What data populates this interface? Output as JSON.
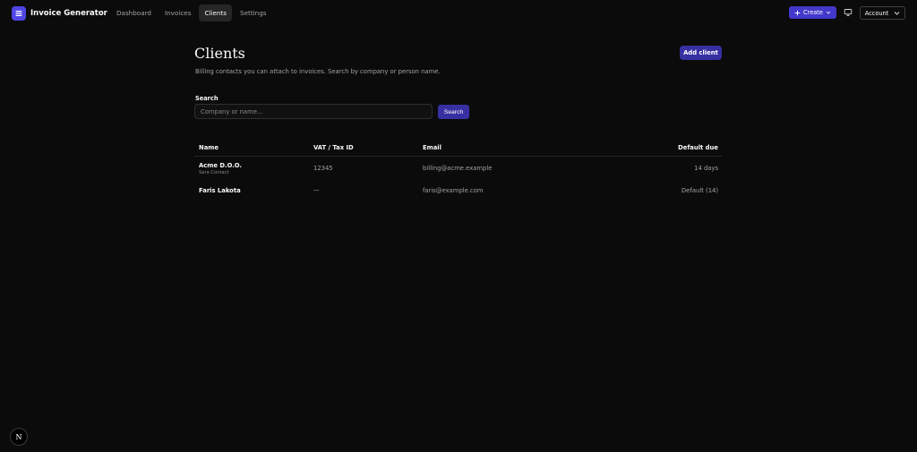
{
  "app": {
    "name": "Invoice Generator",
    "logo_icon": "list-icon",
    "accent": "#4338ca"
  },
  "nav": {
    "items": [
      {
        "label": "Dashboard",
        "active": false
      },
      {
        "label": "Invoices",
        "active": false
      },
      {
        "label": "Clients",
        "active": true
      },
      {
        "label": "Settings",
        "active": false
      }
    ]
  },
  "header_actions": {
    "create_label": "Create",
    "create_icon": "plus-icon",
    "monitor_icon": "monitor-icon",
    "account_label": "Account"
  },
  "page": {
    "title": "Clients",
    "subtitle": "Billing contacts you can attach to invoices. Search by company or person name.",
    "add_button": "Add client"
  },
  "search": {
    "label": "Search",
    "placeholder": "Company or name...",
    "value": "",
    "button": "Search"
  },
  "table": {
    "headers": {
      "name": "Name",
      "vat": "VAT / Tax ID",
      "email": "Email",
      "due": "Default due"
    },
    "rows": [
      {
        "name": "Acme D.O.O.",
        "contact": "Sara Contact",
        "vat": "12345",
        "email": "billing@acme.example",
        "due": "14 days"
      },
      {
        "name": "Faris Lakota",
        "contact": "",
        "vat": "—",
        "email": "faris@example.com",
        "due": "Default (14)"
      }
    ]
  },
  "badge": {
    "letter": "N"
  }
}
